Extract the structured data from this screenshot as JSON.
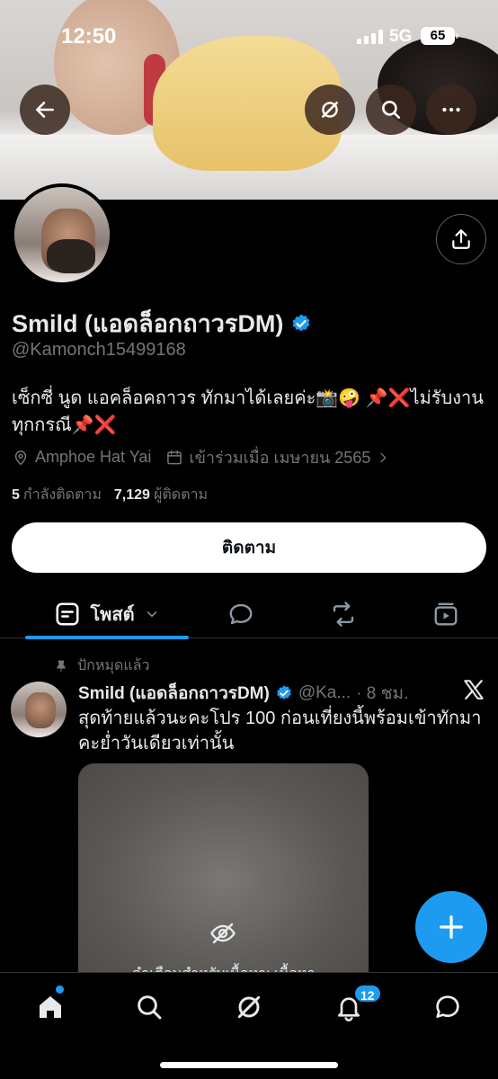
{
  "status_bar": {
    "time": "12:50",
    "network": "5G",
    "battery": "65"
  },
  "profile": {
    "display_name": "Smild (แอดล็อกถาวรDM)",
    "handle": "@Kamonch15499168",
    "bio": "เซ็กซี่ นูด แอคล็อคถาวร ทักมาได้เลยค่ะ📸🤪 📌❌ไม่รับงานทุกกรณี📌❌",
    "location": "Amphoe Hat Yai",
    "joined": "เข้าร่วมเมื่อ เมษายน 2565",
    "following_count": "5",
    "following_label": "กำลังติดตาม",
    "followers_count": "7,129",
    "followers_label": "ผู้ติดตาม",
    "follow_button": "ติดตาม"
  },
  "tabs": {
    "active_label": "โพสต์"
  },
  "pinned_label": "ปักหมุดแล้ว",
  "post": {
    "name": "Smild (แอดล็อกถาวรDM)",
    "handle": "@Ka...",
    "time": "· 8 ชม.",
    "text": "สุดท้ายแล้วนะคะโปร 100 ก่อนเที่ยงนี้พร้อมเข้าทักมาคะย่ำวันเดียวเท่านั้น",
    "media_caption": "คำเตือนสำหรับเนื้อหา: เนื้อหา"
  },
  "notifications_badge": "12",
  "colors": {
    "accent": "#1d9bf0",
    "background": "#000000",
    "muted": "#71767b"
  }
}
